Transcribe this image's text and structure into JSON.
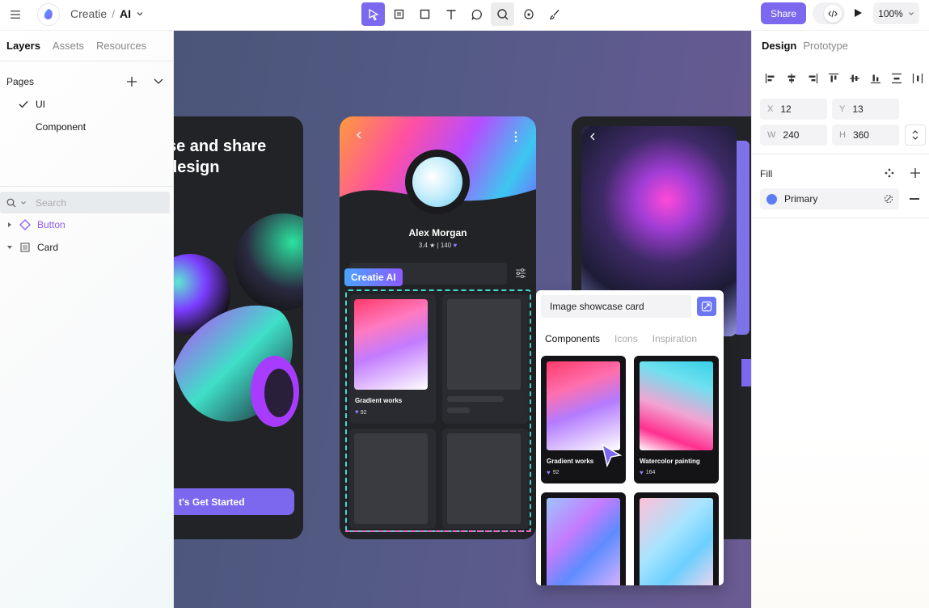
{
  "header": {
    "app_name": "Creatie",
    "separator": "/",
    "file_name": "AI",
    "share_label": "Share",
    "zoom": "100%"
  },
  "left_panel": {
    "tabs": [
      "Layers",
      "Assets",
      "Resources"
    ],
    "pages_title": "Pages",
    "pages": [
      "UI",
      "Component"
    ],
    "search_placeholder": "Search",
    "layers": [
      {
        "label": "Button",
        "kind": "component"
      },
      {
        "label": "Card",
        "kind": "frame"
      }
    ]
  },
  "right_panel": {
    "tabs": [
      "Design",
      "Prototype"
    ],
    "x_label": "X",
    "x": "12",
    "y_label": "Y",
    "y": "13",
    "w_label": "W",
    "w": "240",
    "h_label": "H",
    "h": "360",
    "fill_title": "Fill",
    "fill_name": "Primary",
    "fill_color": "#5b7cf2"
  },
  "canvas": {
    "left_frame": {
      "hero_line1": "se and share",
      "hero_line2": "design",
      "cta": "t's Get Started"
    },
    "mid_frame": {
      "name": "Alex Morgan",
      "stats": "3.4 ★ | 140",
      "badge": "Creatie AI",
      "card_title": "Gradient works",
      "card_likes": "92"
    }
  },
  "popup": {
    "prompt": "Image showcase card",
    "tabs": [
      "Components",
      "Icons",
      "Inspiration"
    ],
    "cards": [
      {
        "title": "Gradient works",
        "likes": "92"
      },
      {
        "title": "Watercolor painting",
        "likes": "164"
      }
    ]
  },
  "colors": {
    "accent": "#7b68ee",
    "selection_cyan": "#48d9d3",
    "selection_pink": "#ff5fbf"
  }
}
